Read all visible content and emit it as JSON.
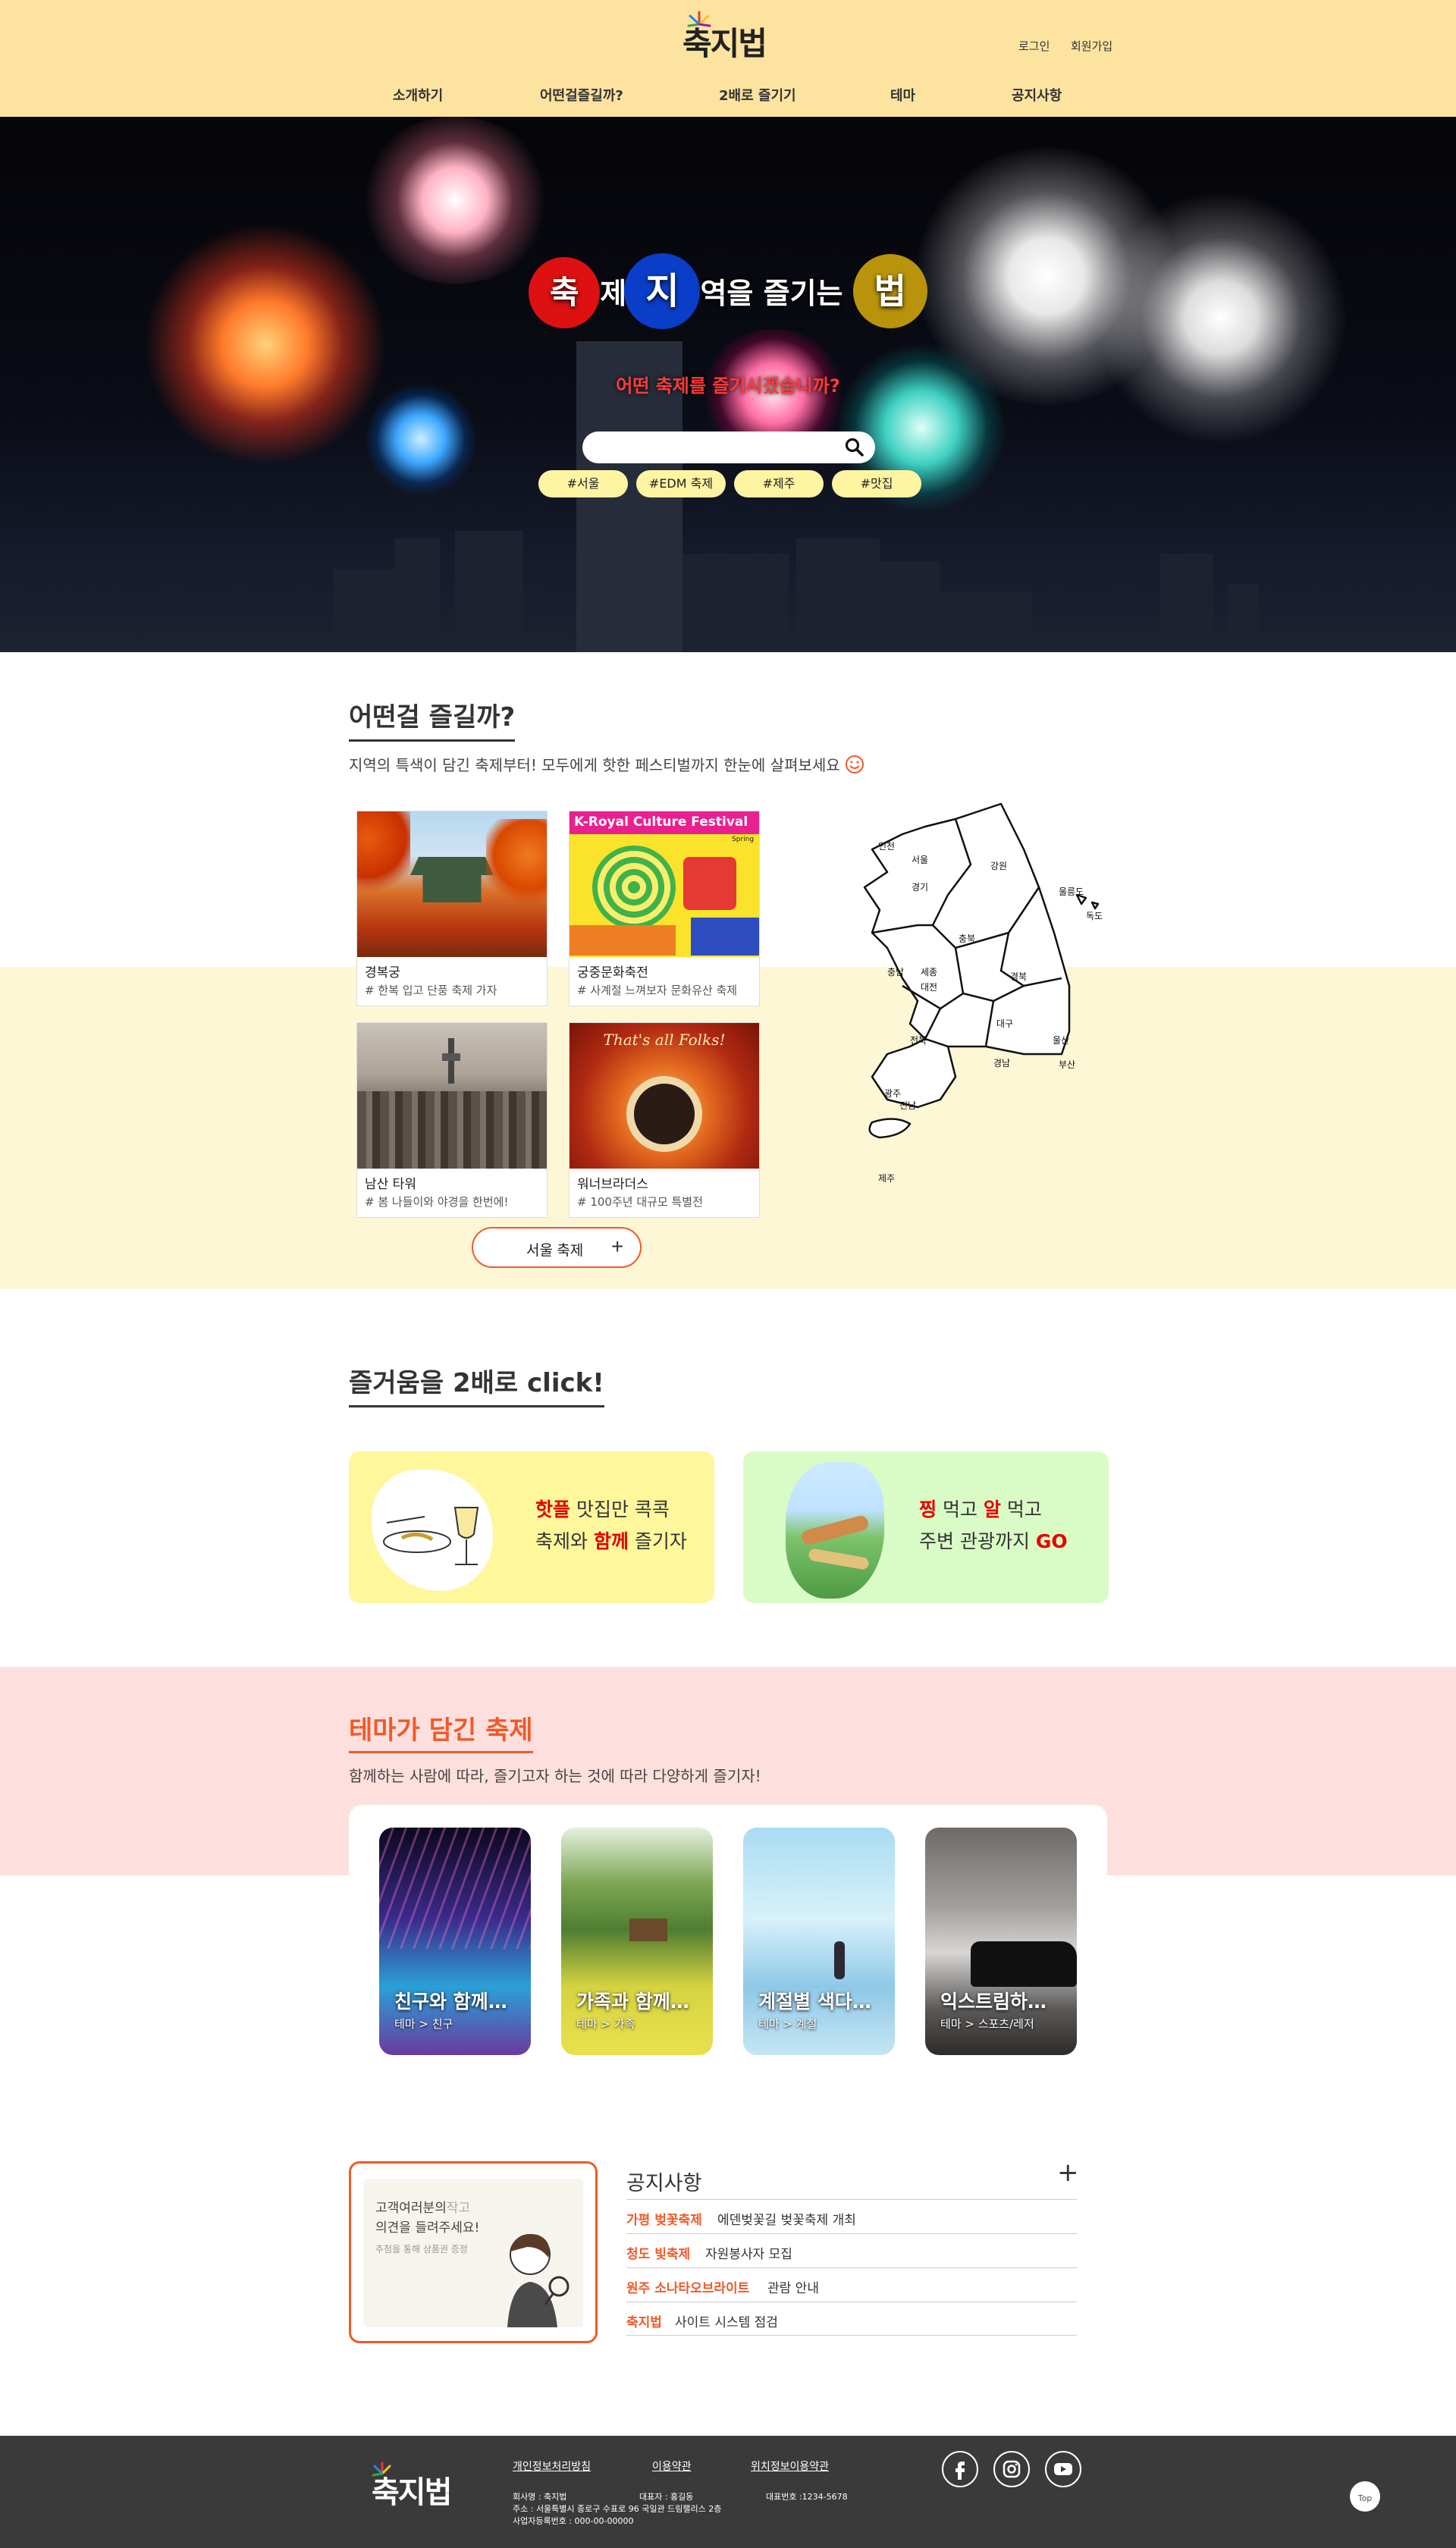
{
  "header": {
    "logo_text": "축지법",
    "login": "로그인",
    "signup": "회원가입",
    "nav": [
      "소개하기",
      "어떤걸즐길까?",
      "2배로 즐기기",
      "테마",
      "공지사항"
    ]
  },
  "hero": {
    "title_parts": [
      "축",
      "제 ",
      "지",
      "역을 즐기는 ",
      "법"
    ],
    "subtitle": "어떤 축제를 즐기시겠습니까?",
    "search_placeholder": "",
    "tags": [
      "#서울",
      "#EDM 축제",
      "#제주",
      "#맛집"
    ]
  },
  "section1": {
    "title": "어떤걸 즐길까?",
    "desc": "지역의 특색이 담긴 축제부터! 모두에게 핫한 페스티벌까지 한눈에 살펴보세요",
    "cards": [
      {
        "name": "경복궁",
        "desc": "# 한복 입고 단풍 축제 가자"
      },
      {
        "name": "궁중문화축전",
        "desc": "# 사계절 느껴보자 문화유산 축제"
      },
      {
        "name": "남산 타워",
        "desc": "# 봄 나들이와 야경을 한번에!"
      },
      {
        "name": "워너브라더스",
        "desc": "# 100주년 대규모 특별전"
      }
    ],
    "card_banner_text": "K-Royal Culture Festival",
    "card_banner_sub": "Spring",
    "card_banner_wb": "That's all Folks!",
    "more_button": "서울 축제",
    "map_regions": [
      "인천",
      "서울",
      "경기",
      "강원",
      "울릉도",
      "독도",
      "충북",
      "충남",
      "세종",
      "대전",
      "경북",
      "전북",
      "대구",
      "울산",
      "경남",
      "부산",
      "광주",
      "전남",
      "제주"
    ]
  },
  "section2": {
    "title": "즐거움을 2배로 click!",
    "box1": {
      "line1_red": "핫플",
      "line1_rest": " 맛집만 콕콕",
      "line2_a": "축제와 ",
      "line2_red": "함께",
      "line2_b": " 즐기자"
    },
    "box2": {
      "line1_red1": "찡",
      "line1_mid": " 먹고 ",
      "line1_red2": "알",
      "line1_rest": " 먹고",
      "line2_a": "주변 관광까지 ",
      "line2_red": "GO"
    }
  },
  "section3": {
    "title": "테마가 담긴 축제",
    "desc": "함께하는 사람에 따라, 즐기고자 하는 것에 따라 다양하게 즐기자!",
    "themes": [
      {
        "name": "친구와 함께…",
        "cat": "테마 > 친구"
      },
      {
        "name": "가족과 함께…",
        "cat": "테마 > 가족"
      },
      {
        "name": "계절별 색다…",
        "cat": "테마 > 계절"
      },
      {
        "name": "익스트림하…",
        "cat": "테마 > 스포츠/레저"
      }
    ]
  },
  "section4": {
    "ad_line1": "고객여러분의",
    "ad_line1_b": "작고",
    "ad_line2": "의견을 들려주세요!",
    "ad_line3": "추첨을 통해 상품권 증정",
    "notice_title": "공지사항",
    "notices": [
      {
        "cat": "가평 벚꽃축제",
        "title": "에덴벚꽃길 벚꽃축제 개최"
      },
      {
        "cat": "청도 빛축제",
        "title": "자원봉사자 모집"
      },
      {
        "cat": "원주 소나타오브라이트",
        "title": "관람 안내"
      },
      {
        "cat": "축지법",
        "title": "사이트 시스템 점검"
      }
    ]
  },
  "footer": {
    "logo_text": "축지법",
    "links": [
      "개인정보처리방침",
      "이용약관",
      "위치정보이용약관"
    ],
    "company": "회사명 : 축지법",
    "ceo": "대표자 : 홍길동",
    "tel": "대표번호 :1234-5678",
    "address": "주소 : 서울특별시 종로구 수표로 96 국일관 드림팰리스 2층",
    "bizno": "사업자등록번호 : 000-00-00000",
    "top": "Top"
  },
  "colors": {
    "accent": "#f05a28",
    "header_bg": "#fde3a0",
    "tag_bg": "#fef4a2",
    "theme_bg": "#fde0de",
    "box1_bg": "#fef79c",
    "box2_bg": "#d9fbc6"
  }
}
